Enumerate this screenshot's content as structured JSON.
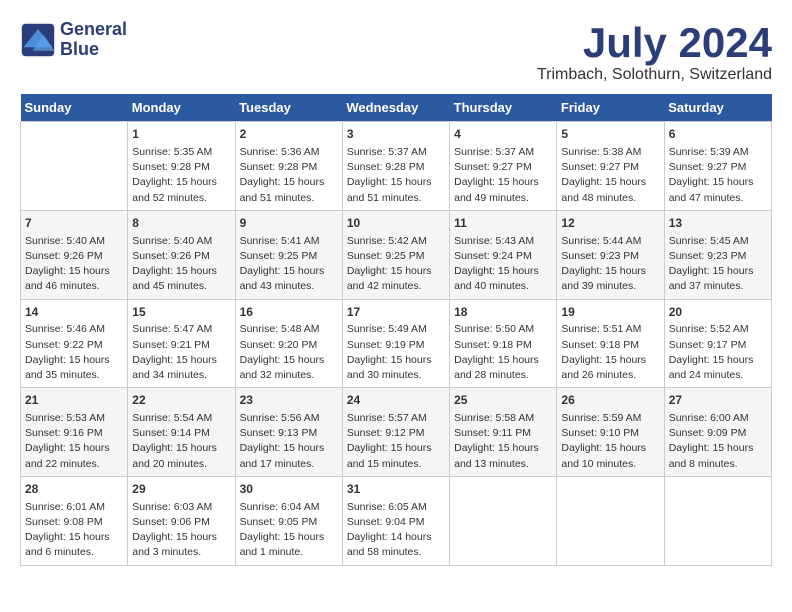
{
  "logo": {
    "line1": "General",
    "line2": "Blue"
  },
  "title": "July 2024",
  "subtitle": "Trimbach, Solothurn, Switzerland",
  "days_of_week": [
    "Sunday",
    "Monday",
    "Tuesday",
    "Wednesday",
    "Thursday",
    "Friday",
    "Saturday"
  ],
  "weeks": [
    [
      {
        "day": "",
        "content": ""
      },
      {
        "day": "1",
        "content": "Sunrise: 5:35 AM\nSunset: 9:28 PM\nDaylight: 15 hours\nand 52 minutes."
      },
      {
        "day": "2",
        "content": "Sunrise: 5:36 AM\nSunset: 9:28 PM\nDaylight: 15 hours\nand 51 minutes."
      },
      {
        "day": "3",
        "content": "Sunrise: 5:37 AM\nSunset: 9:28 PM\nDaylight: 15 hours\nand 51 minutes."
      },
      {
        "day": "4",
        "content": "Sunrise: 5:37 AM\nSunset: 9:27 PM\nDaylight: 15 hours\nand 49 minutes."
      },
      {
        "day": "5",
        "content": "Sunrise: 5:38 AM\nSunset: 9:27 PM\nDaylight: 15 hours\nand 48 minutes."
      },
      {
        "day": "6",
        "content": "Sunrise: 5:39 AM\nSunset: 9:27 PM\nDaylight: 15 hours\nand 47 minutes."
      }
    ],
    [
      {
        "day": "7",
        "content": "Sunrise: 5:40 AM\nSunset: 9:26 PM\nDaylight: 15 hours\nand 46 minutes."
      },
      {
        "day": "8",
        "content": "Sunrise: 5:40 AM\nSunset: 9:26 PM\nDaylight: 15 hours\nand 45 minutes."
      },
      {
        "day": "9",
        "content": "Sunrise: 5:41 AM\nSunset: 9:25 PM\nDaylight: 15 hours\nand 43 minutes."
      },
      {
        "day": "10",
        "content": "Sunrise: 5:42 AM\nSunset: 9:25 PM\nDaylight: 15 hours\nand 42 minutes."
      },
      {
        "day": "11",
        "content": "Sunrise: 5:43 AM\nSunset: 9:24 PM\nDaylight: 15 hours\nand 40 minutes."
      },
      {
        "day": "12",
        "content": "Sunrise: 5:44 AM\nSunset: 9:23 PM\nDaylight: 15 hours\nand 39 minutes."
      },
      {
        "day": "13",
        "content": "Sunrise: 5:45 AM\nSunset: 9:23 PM\nDaylight: 15 hours\nand 37 minutes."
      }
    ],
    [
      {
        "day": "14",
        "content": "Sunrise: 5:46 AM\nSunset: 9:22 PM\nDaylight: 15 hours\nand 35 minutes."
      },
      {
        "day": "15",
        "content": "Sunrise: 5:47 AM\nSunset: 9:21 PM\nDaylight: 15 hours\nand 34 minutes."
      },
      {
        "day": "16",
        "content": "Sunrise: 5:48 AM\nSunset: 9:20 PM\nDaylight: 15 hours\nand 32 minutes."
      },
      {
        "day": "17",
        "content": "Sunrise: 5:49 AM\nSunset: 9:19 PM\nDaylight: 15 hours\nand 30 minutes."
      },
      {
        "day": "18",
        "content": "Sunrise: 5:50 AM\nSunset: 9:18 PM\nDaylight: 15 hours\nand 28 minutes."
      },
      {
        "day": "19",
        "content": "Sunrise: 5:51 AM\nSunset: 9:18 PM\nDaylight: 15 hours\nand 26 minutes."
      },
      {
        "day": "20",
        "content": "Sunrise: 5:52 AM\nSunset: 9:17 PM\nDaylight: 15 hours\nand 24 minutes."
      }
    ],
    [
      {
        "day": "21",
        "content": "Sunrise: 5:53 AM\nSunset: 9:16 PM\nDaylight: 15 hours\nand 22 minutes."
      },
      {
        "day": "22",
        "content": "Sunrise: 5:54 AM\nSunset: 9:14 PM\nDaylight: 15 hours\nand 20 minutes."
      },
      {
        "day": "23",
        "content": "Sunrise: 5:56 AM\nSunset: 9:13 PM\nDaylight: 15 hours\nand 17 minutes."
      },
      {
        "day": "24",
        "content": "Sunrise: 5:57 AM\nSunset: 9:12 PM\nDaylight: 15 hours\nand 15 minutes."
      },
      {
        "day": "25",
        "content": "Sunrise: 5:58 AM\nSunset: 9:11 PM\nDaylight: 15 hours\nand 13 minutes."
      },
      {
        "day": "26",
        "content": "Sunrise: 5:59 AM\nSunset: 9:10 PM\nDaylight: 15 hours\nand 10 minutes."
      },
      {
        "day": "27",
        "content": "Sunrise: 6:00 AM\nSunset: 9:09 PM\nDaylight: 15 hours\nand 8 minutes."
      }
    ],
    [
      {
        "day": "28",
        "content": "Sunrise: 6:01 AM\nSunset: 9:08 PM\nDaylight: 15 hours\nand 6 minutes."
      },
      {
        "day": "29",
        "content": "Sunrise: 6:03 AM\nSunset: 9:06 PM\nDaylight: 15 hours\nand 3 minutes."
      },
      {
        "day": "30",
        "content": "Sunrise: 6:04 AM\nSunset: 9:05 PM\nDaylight: 15 hours\nand 1 minute."
      },
      {
        "day": "31",
        "content": "Sunrise: 6:05 AM\nSunset: 9:04 PM\nDaylight: 14 hours\nand 58 minutes."
      },
      {
        "day": "",
        "content": ""
      },
      {
        "day": "",
        "content": ""
      },
      {
        "day": "",
        "content": ""
      }
    ]
  ]
}
